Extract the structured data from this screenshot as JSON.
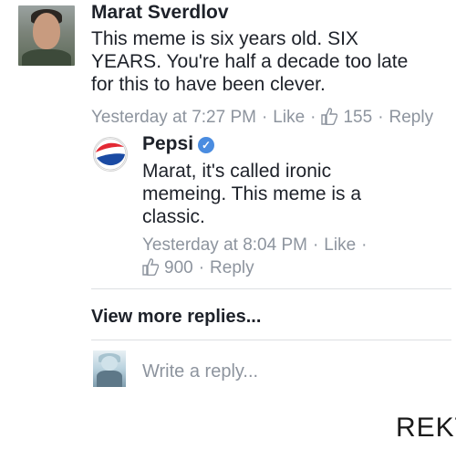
{
  "comment": {
    "author": "Marat Sverdlov",
    "lines": [
      "This meme is six years old. SIX",
      "YEARS. You're half a decade too late",
      "for this to have been clever."
    ],
    "timestamp": "Yesterday at 7:27 PM",
    "like_label": "Like",
    "like_count": "155",
    "reply_label": "Reply"
  },
  "reply": {
    "author": "Pepsi",
    "verified_glyph": "✓",
    "lines": [
      "Marat, it's called ironic",
      "memeing. This meme is a",
      "classic."
    ],
    "timestamp": "Yesterday at 8:04 PM",
    "like_label": "Like",
    "like_count": "900",
    "reply_label": "Reply"
  },
  "view_more": "View more replies...",
  "write_reply_placeholder": "Write a reply...",
  "caption": "REKT",
  "colors": {
    "meta_gray": "#8d949e",
    "verified_blue": "#4a8ce0",
    "pepsi_red": "#e32934",
    "pepsi_blue": "#1a4aa3"
  }
}
